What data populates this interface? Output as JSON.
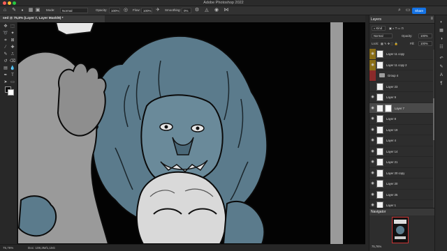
{
  "app": {
    "title": "Adobe Photoshop 2022",
    "document_tab": "sed @ 75,8% (Layer 7, Layer Mask/8) *"
  },
  "options_bar": {
    "mode_label": "Mode:",
    "mode_value": "Normal",
    "opacity_label": "Opacity:",
    "opacity_value": "100%",
    "flow_label": "Flow:",
    "flow_value": "100%",
    "smoothing_label": "Smoothing:",
    "smoothing_value": "0%",
    "share_label": "Share"
  },
  "status_bar": {
    "zoom": "75,76%",
    "doc_info": "Doc: 108,3M/1,15G"
  },
  "layers_panel": {
    "tab_label": "Layers",
    "filter_kind": "Kind",
    "blend_mode": "Normal",
    "opacity_label": "Opacity:",
    "opacity_value": "100%",
    "lock_label": "Lock:",
    "fill_label": "Fill:",
    "fill_value": "100%",
    "layers": [
      {
        "name": "Layer 11 copy",
        "visible": true,
        "highlight": "yellow",
        "selected": false
      },
      {
        "name": "Layer 11 copy 2",
        "visible": true,
        "highlight": "yellow",
        "selected": false
      },
      {
        "name": "Group 4",
        "visible": false,
        "highlight": "red",
        "group": true,
        "selected": false
      },
      {
        "name": "Layer 23",
        "visible": false,
        "highlight": "",
        "selected": false
      },
      {
        "name": "Layer 9",
        "visible": true,
        "highlight": "",
        "selected": false
      },
      {
        "name": "Layer 7",
        "visible": true,
        "highlight": "",
        "selected": true,
        "mask": true
      },
      {
        "name": "Layer 8",
        "visible": true,
        "highlight": "",
        "selected": false
      },
      {
        "name": "Layer 19",
        "visible": true,
        "highlight": "",
        "selected": false
      },
      {
        "name": "Layer 4",
        "visible": true,
        "highlight": "",
        "selected": false
      },
      {
        "name": "Layer 14",
        "visible": true,
        "highlight": "",
        "selected": false
      },
      {
        "name": "Layer 21",
        "visible": true,
        "highlight": "",
        "selected": false
      },
      {
        "name": "Layer 20 copy",
        "visible": true,
        "highlight": "",
        "selected": false
      },
      {
        "name": "Layer 20",
        "visible": true,
        "highlight": "",
        "selected": false
      },
      {
        "name": "Layer 25",
        "visible": true,
        "highlight": "",
        "selected": false
      },
      {
        "name": "Layer 1",
        "visible": true,
        "highlight": "",
        "selected": false
      }
    ]
  },
  "navigator": {
    "tab_label": "Navigator",
    "zoom": "75,76%"
  },
  "colors": {
    "accent": "#1473e6",
    "artwork_blue": "#5b7b8c",
    "artwork_gray": "#8c8c8c",
    "yellow_tag": "#8a6e16",
    "red_tag": "#8a2a2a"
  }
}
